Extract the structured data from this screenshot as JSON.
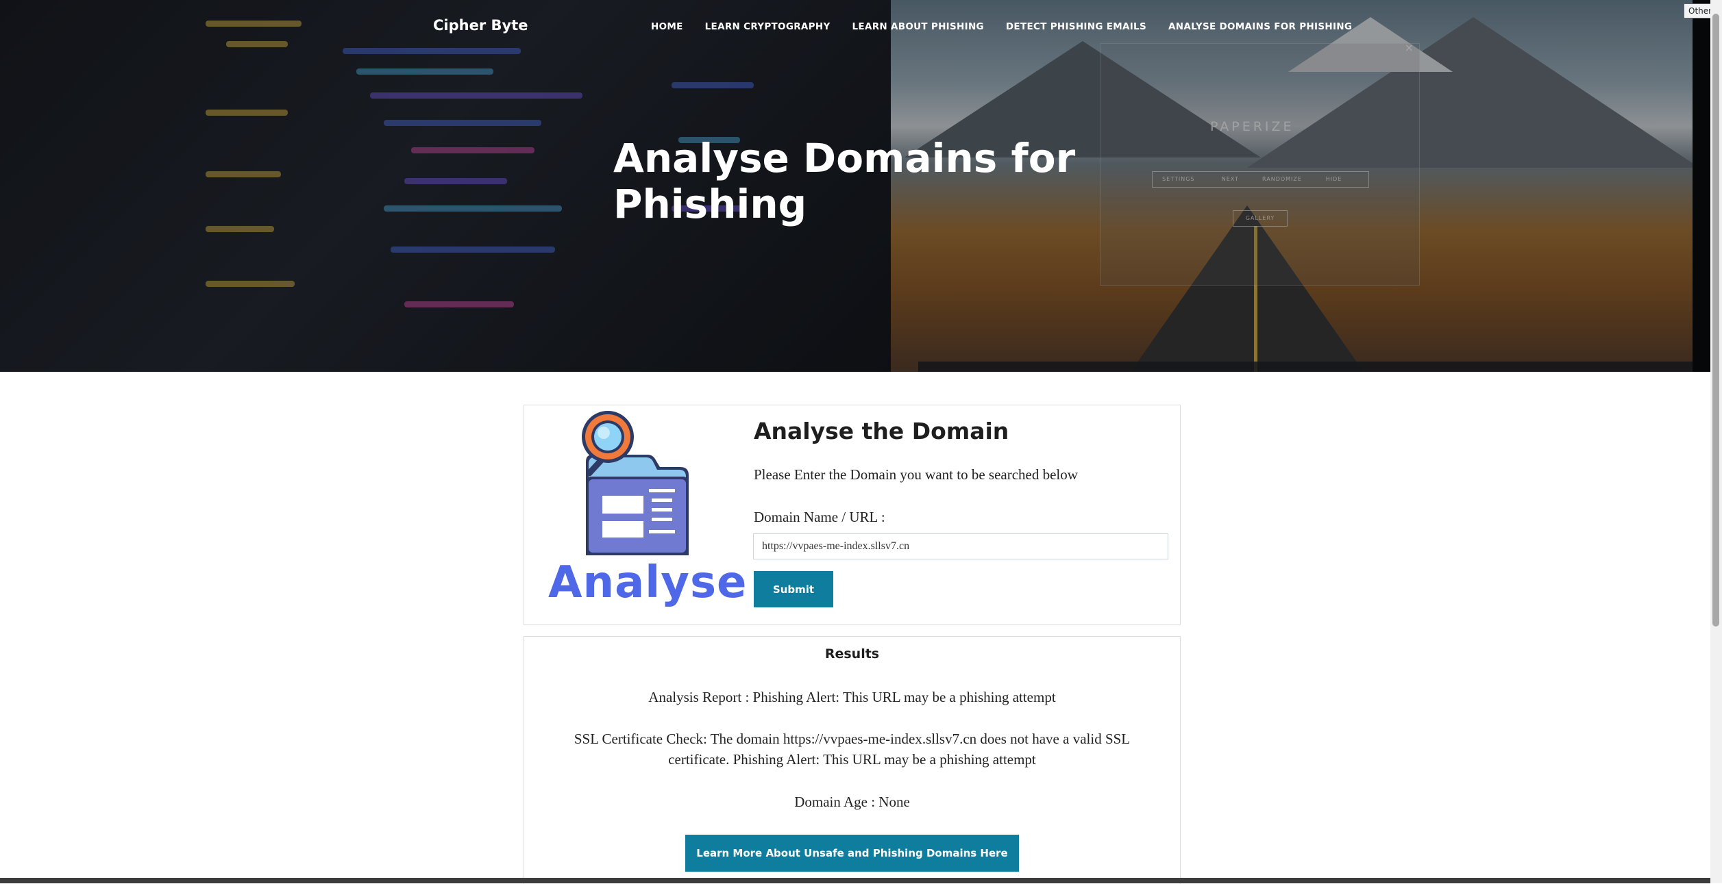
{
  "header": {
    "brand": "Cipher Byte",
    "nav": [
      {
        "label": "Home"
      },
      {
        "label": "Learn Cryptography"
      },
      {
        "label": "Learn About Phishing"
      },
      {
        "label": "Detect Phishing Emails"
      },
      {
        "label": "Analyse Domains for Phishing"
      }
    ],
    "hero_title": "Analyse Domains for Phishing",
    "background_app": {
      "title": "PAPERIZE",
      "buttons": [
        "SETTINGS",
        "NEXT",
        "RANDOMIZE",
        "HIDE"
      ],
      "secondary_button": "GALLERY"
    }
  },
  "browser": {
    "bookmark_label": "Other fav"
  },
  "analyse": {
    "illustration_word": "Analyse",
    "title": "Analyse the Domain",
    "prompt": "Please Enter the Domain you want to be searched below",
    "field_label": "Domain Name / URL :",
    "field_value": "https://vvpaes-me-index.sllsv7.cn",
    "submit_label": "Submit"
  },
  "results": {
    "title": "Results",
    "analysis_report": "Analysis Report : Phishing Alert: This URL may be a phishing attempt",
    "ssl_check": "SSL Certificate Check: The domain https://vvpaes-me-index.sllsv7.cn does not have a valid SSL certificate. Phishing Alert: This URL may be a phishing attempt",
    "domain_age": "Domain Age : None",
    "learn_more_label": "Learn More About Unsafe and Phishing Domains Here"
  },
  "colors": {
    "accent": "#0f7e9e",
    "illustration_blue": "#4f68e8"
  }
}
